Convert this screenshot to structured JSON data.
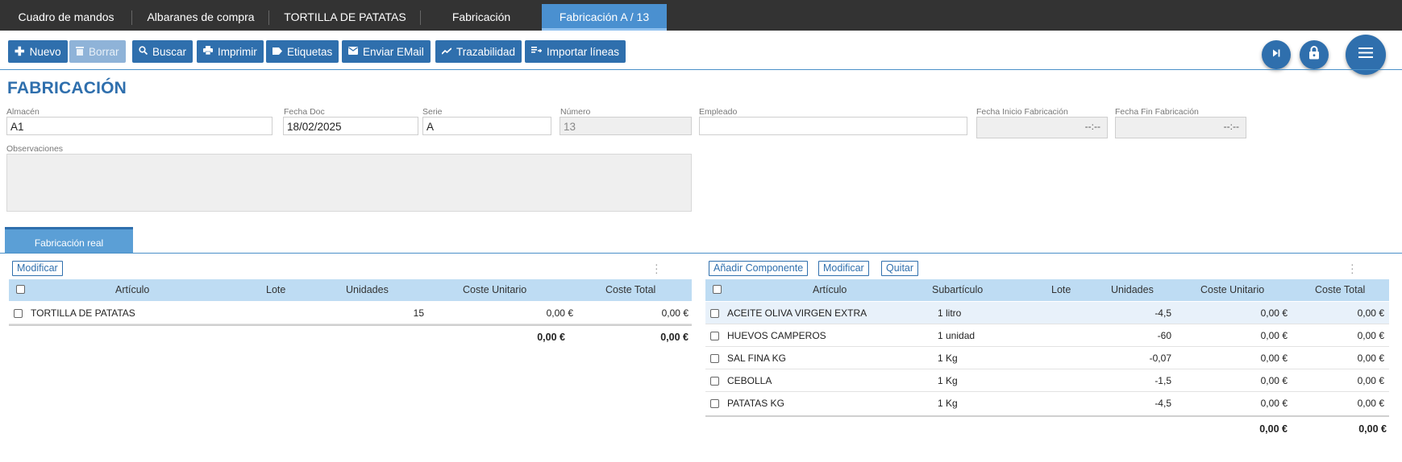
{
  "top_tabs": [
    {
      "label": "Cuadro de mandos"
    },
    {
      "label": "Albaranes de compra"
    },
    {
      "label": "TORTILLA DE PATATAS"
    },
    {
      "label": "Fabricación"
    },
    {
      "label": "Fabricación A / 13",
      "active": true
    }
  ],
  "toolbar": {
    "nuevo": "Nuevo",
    "borrar": "Borrar",
    "buscar": "Buscar",
    "imprimir": "Imprimir",
    "etiquetas": "Etiquetas",
    "enviar_email": "Enviar EMail",
    "trazabilidad": "Trazabilidad",
    "importar_lineas": "Importar líneas"
  },
  "page_title": "FABRICACIÓN",
  "form": {
    "almacen_label": "Almacén",
    "almacen": "A1",
    "fecha_doc_label": "Fecha Doc",
    "fecha_doc": "18/02/2025",
    "serie_label": "Serie",
    "serie": "A",
    "numero_label": "Número",
    "numero": "13",
    "empleado_label": "Empleado",
    "empleado": "",
    "fecha_inicio_label": "Fecha Inicio Fabricación",
    "fecha_inicio_time": "--:--",
    "fecha_fin_label": "Fecha Fin Fabricación",
    "fecha_fin_time": "--:--",
    "observaciones_label": "Observaciones",
    "observaciones": ""
  },
  "section_tab": "Fabricación real",
  "left_panel": {
    "modificar": "Modificar",
    "headers": {
      "articulo": "Artículo",
      "lote": "Lote",
      "unidades": "Unidades",
      "coste_unitario": "Coste Unitario",
      "coste_total": "Coste Total"
    },
    "rows": [
      {
        "articulo": "TORTILLA DE PATATAS",
        "lote": "",
        "unidades": "15",
        "coste_unitario": "0,00 €",
        "coste_total": "0,00 €"
      }
    ],
    "totals": {
      "coste_unitario": "0,00 €",
      "coste_total": "0,00 €"
    }
  },
  "right_panel": {
    "anadir": "Añadir Componente",
    "modificar": "Modificar",
    "quitar": "Quitar",
    "headers": {
      "articulo": "Artículo",
      "subarticulo": "Subartículo",
      "lote": "Lote",
      "unidades": "Unidades",
      "coste_unitario": "Coste Unitario",
      "coste_total": "Coste Total"
    },
    "rows": [
      {
        "articulo": "ACEITE OLIVA VIRGEN EXTRA",
        "subarticulo": "1 litro",
        "lote": "",
        "unidades": "-4,5",
        "coste_unitario": "0,00 €",
        "coste_total": "0,00 €"
      },
      {
        "articulo": "HUEVOS CAMPEROS",
        "subarticulo": "1 unidad",
        "lote": "",
        "unidades": "-60",
        "coste_unitario": "0,00 €",
        "coste_total": "0,00 €"
      },
      {
        "articulo": "SAL FINA KG",
        "subarticulo": "1 Kg",
        "lote": "",
        "unidades": "-0,07",
        "coste_unitario": "0,00 €",
        "coste_total": "0,00 €"
      },
      {
        "articulo": "CEBOLLA",
        "subarticulo": "1 Kg",
        "lote": "",
        "unidades": "-1,5",
        "coste_unitario": "0,00 €",
        "coste_total": "0,00 €"
      },
      {
        "articulo": "PATATAS KG",
        "subarticulo": "1 Kg",
        "lote": "",
        "unidades": "-4,5",
        "coste_unitario": "0,00 €",
        "coste_total": "0,00 €"
      }
    ],
    "totals": {
      "coste_unitario": "0,00 €",
      "coste_total": "0,00 €"
    }
  },
  "icons": {
    "nuevo": "plus-icon",
    "borrar": "trash-icon",
    "buscar": "search-icon",
    "imprimir": "printer-icon",
    "etiquetas": "label-icon",
    "enviar_email": "envelope-icon",
    "trazabilidad": "trend-icon",
    "importar_lineas": "import-list-icon",
    "next": "skip-next-icon",
    "lock": "lock-icon",
    "menu": "hamburger-menu-icon"
  },
  "colors": {
    "primary": "#2f6fad",
    "active_tab": "#4a90d0",
    "header_bg": "#bedcf3",
    "topbar": "#333333"
  }
}
